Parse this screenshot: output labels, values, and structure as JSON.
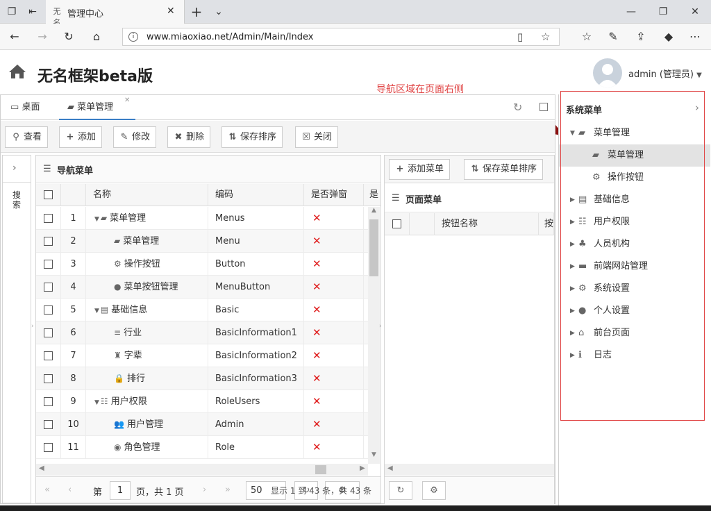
{
  "browser": {
    "tab_title": "管理中心",
    "favicon_text": "无名",
    "url": "www.miaoxiao.net/Admin/Main/Index"
  },
  "app": {
    "title": "无名框架beta版",
    "user": "admin (管理员)",
    "annotation": "导航区域在页面右侧"
  },
  "main_tabs": [
    {
      "label": "桌面"
    },
    {
      "label": "菜单管理"
    }
  ],
  "toolbar": {
    "view": "查看",
    "add": "添加",
    "edit": "修改",
    "delete": "删除",
    "save_sort": "保存排序",
    "close": "关闭"
  },
  "left_strip": {
    "label": "搜索"
  },
  "grid": {
    "title": "导航菜单",
    "columns": [
      "名称",
      "编码",
      "是否弹窗",
      "是"
    ],
    "rows": [
      {
        "no": "1",
        "name": "菜单管理",
        "code": "Menus"
      },
      {
        "no": "2",
        "name": "菜单管理",
        "code": "Menu"
      },
      {
        "no": "3",
        "name": "操作按钮",
        "code": "Button"
      },
      {
        "no": "4",
        "name": "菜单按钮管理",
        "code": "MenuButton"
      },
      {
        "no": "5",
        "name": "基础信息",
        "code": "Basic"
      },
      {
        "no": "6",
        "name": "行业",
        "code": "BasicInformation1"
      },
      {
        "no": "7",
        "name": "字辈",
        "code": "BasicInformation2"
      },
      {
        "no": "8",
        "name": "排行",
        "code": "BasicInformation3"
      },
      {
        "no": "9",
        "name": "用户权限",
        "code": "RoleUsers"
      },
      {
        "no": "10",
        "name": "用户管理",
        "code": "Admin"
      },
      {
        "no": "11",
        "name": "角色管理",
        "code": "Role"
      }
    ],
    "popup_mark": "✕",
    "pager": {
      "page_label": "第",
      "page_value": "1",
      "page_total": "页，共 1 页",
      "page_size": "50",
      "summary": "显示 1 到 43 条，共 43 条"
    }
  },
  "page_menu": {
    "add_button": "添加菜单",
    "save_button": "保存菜单排序",
    "title": "页面菜单",
    "column": "按钮名称",
    "column2": "按"
  },
  "nav_panel": {
    "title": "系统菜单",
    "items": [
      {
        "label": "菜单管理",
        "expanded": true
      },
      {
        "label": "菜单管理",
        "child": true,
        "selected": true
      },
      {
        "label": "操作按钮",
        "child": true
      },
      {
        "label": "基础信息"
      },
      {
        "label": "用户权限"
      },
      {
        "label": "人员机构"
      },
      {
        "label": "前端网站管理"
      },
      {
        "label": "系统设置"
      },
      {
        "label": "个人设置"
      },
      {
        "label": "前台页面"
      },
      {
        "label": "日志"
      }
    ]
  },
  "colors": {
    "accent": "#3a7ec6",
    "annotation": "#e04545",
    "popup_no": "#e02020"
  }
}
